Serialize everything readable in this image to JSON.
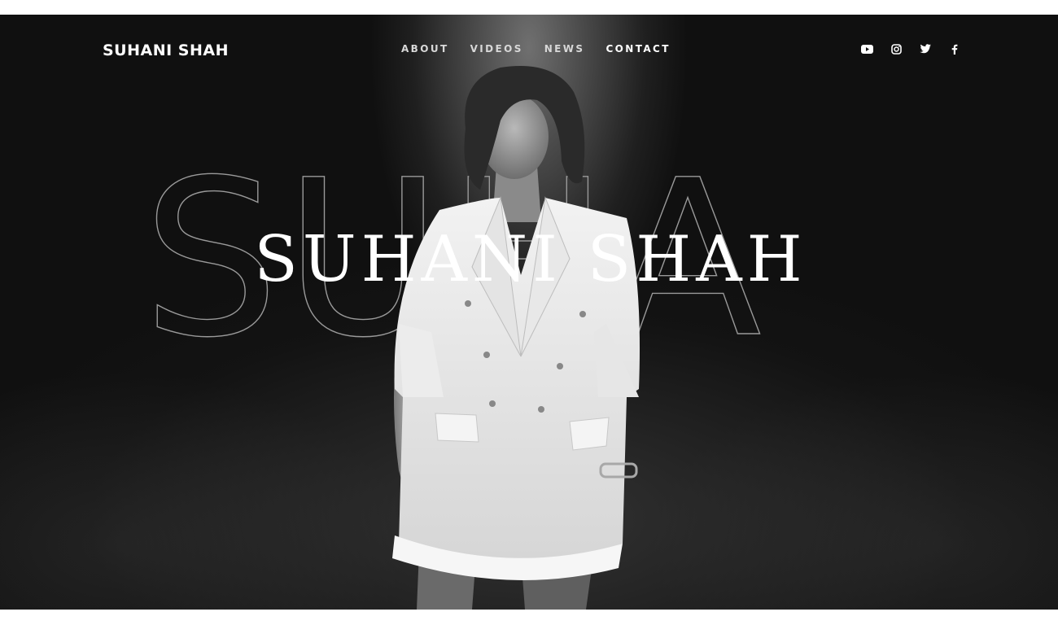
{
  "header": {
    "brand": "SUHANI SHAH",
    "nav": [
      {
        "label": "ABOUT"
      },
      {
        "label": "VIDEOS"
      },
      {
        "label": "NEWS"
      },
      {
        "label": "CONTACT"
      }
    ],
    "social": [
      {
        "icon": "youtube-icon"
      },
      {
        "icon": "instagram-icon"
      },
      {
        "icon": "twitter-icon"
      },
      {
        "icon": "facebook-icon"
      }
    ]
  },
  "hero": {
    "outline_text": "SUHA",
    "headline": "SUHANI SHAH"
  },
  "colors": {
    "background": "#101010",
    "text": "#ffffff",
    "nav_text": "#d8d8d8"
  }
}
